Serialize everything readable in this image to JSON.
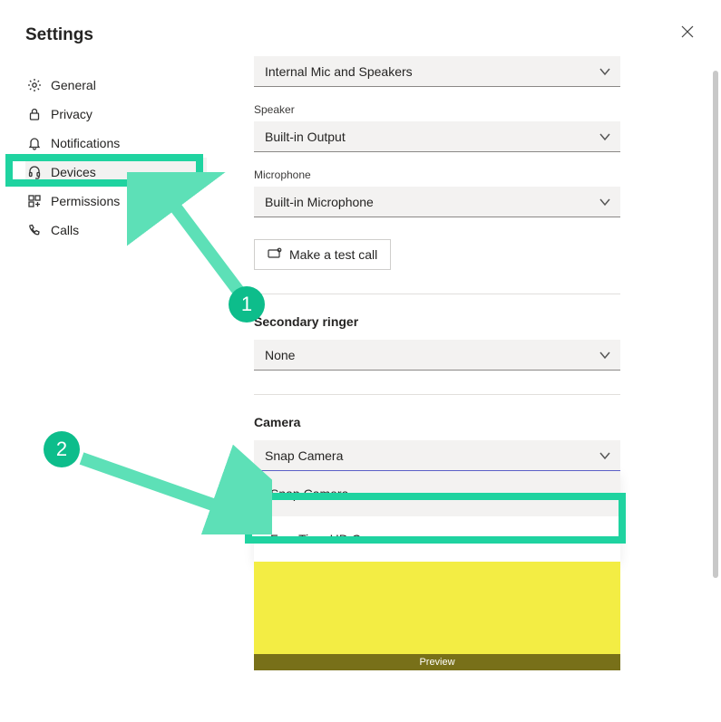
{
  "title": "Settings",
  "sidebar": {
    "items": [
      {
        "label": "General"
      },
      {
        "label": "Privacy"
      },
      {
        "label": "Notifications"
      },
      {
        "label": "Devices"
      },
      {
        "label": "Permissions"
      },
      {
        "label": "Calls"
      }
    ]
  },
  "devices": {
    "audio_combo_value": "Internal Mic and Speakers",
    "speaker_label": "Speaker",
    "speaker_value": "Built-in Output",
    "microphone_label": "Microphone",
    "microphone_value": "Built-in Microphone",
    "test_call_label": "Make a test call",
    "secondary_ringer_label": "Secondary ringer",
    "secondary_ringer_value": "None",
    "camera_label": "Camera",
    "camera_value": "Snap Camera",
    "camera_options": [
      "Snap Camera",
      "FaceTime HD Camera"
    ],
    "preview_label": "Preview"
  },
  "annotations": {
    "badge1": "1",
    "badge2": "2"
  }
}
